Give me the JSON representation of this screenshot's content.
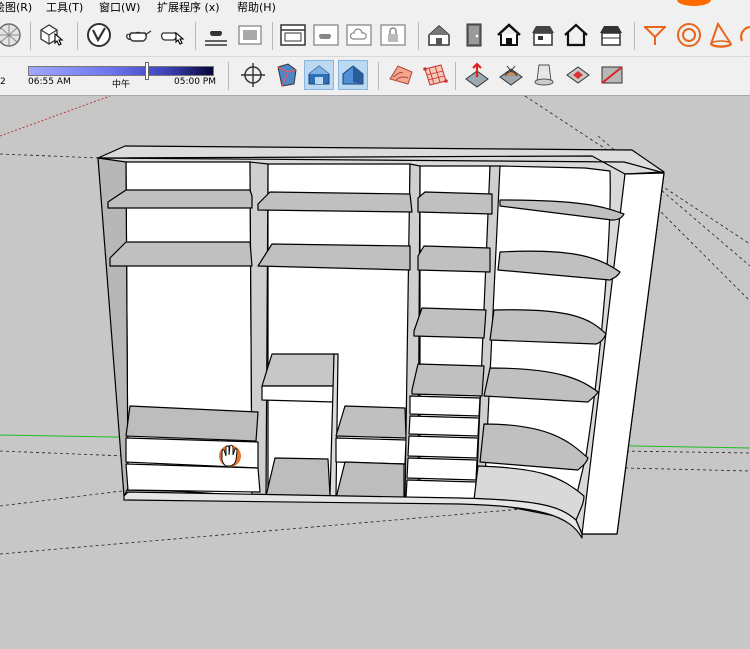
{
  "menu": {
    "items": [
      {
        "label": "绘图(R)"
      },
      {
        "label": "工具(T)"
      },
      {
        "label": "窗口(W)"
      },
      {
        "label": "扩展程序 (x)"
      },
      {
        "label": "帮助(H)"
      }
    ]
  },
  "shadow": {
    "month_stub": "2",
    "time_start": "06:55 AM",
    "time_noon": "中午",
    "time_end": "05:00 PM",
    "slider_position": 0.64
  },
  "colors": {
    "ui_bg": "#f0f0f0",
    "viewport_bg": "#c7c7c7",
    "panel_fill": "#ffffff",
    "panel_shade": "#d9d9d9",
    "edge": "#000000",
    "axis_green": "#1fbd1f",
    "axis_red": "#c53434",
    "accent_orange": "#e8661b",
    "active_tool": "#bcd9f2"
  },
  "icons": {
    "toolbar1": [
      "sphere-icon",
      "component-cursor-icon",
      "vray-logo-icon",
      "teapot-icon",
      "teapot-hand-icon",
      "render-region-icon",
      "frame-buffer-icon",
      "window-icon",
      "window-teapot-icon",
      "cloud-icon",
      "lock-icon",
      "house-book-icon",
      "door-icon",
      "house-solid-icon",
      "house-roof-icon",
      "house-outline-icon",
      "house-flat-icon",
      "funnel-icon",
      "torus-icon",
      "cone-icon",
      "ring-icon"
    ],
    "toolbar2": [
      "orbit-icon",
      "box-gradient-icon",
      "house-blue-icon",
      "house-blue-alt-icon",
      "terrain-icon",
      "grid-icon",
      "terrain-arrow-icon",
      "terrain-bump-icon",
      "drape-icon",
      "stamp-icon",
      "flip-icon"
    ]
  }
}
